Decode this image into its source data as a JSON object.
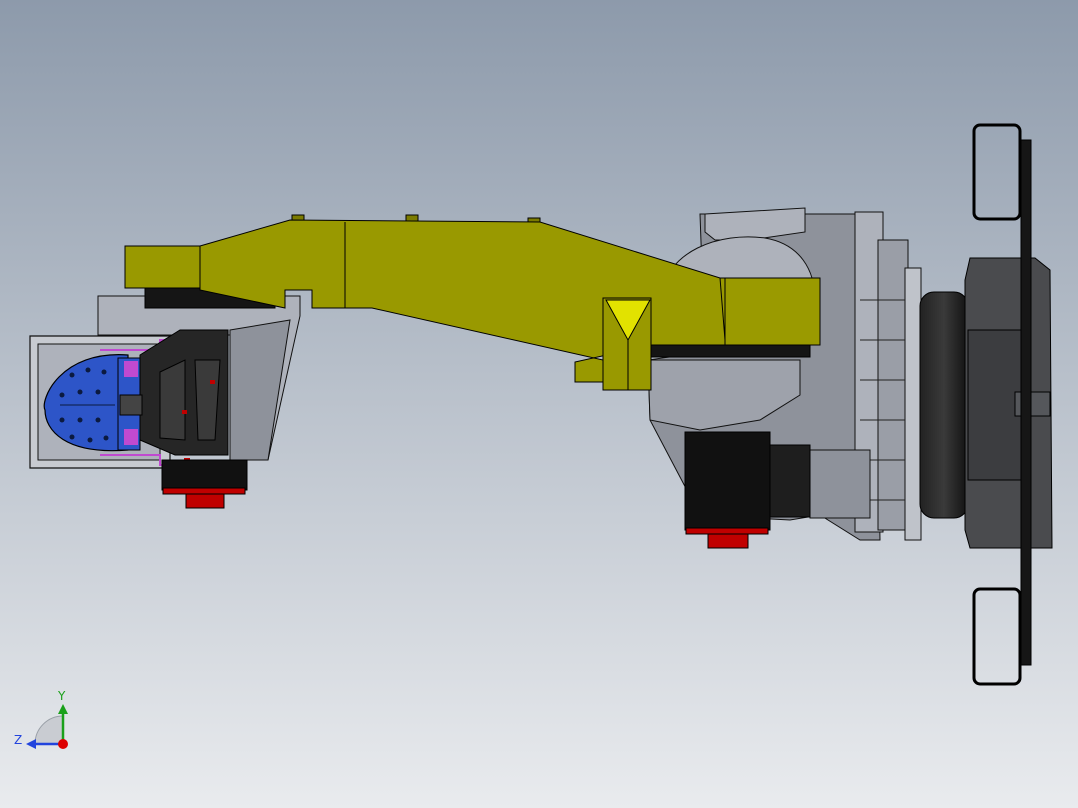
{
  "viewport": {
    "background_top": "#8d9aab",
    "background_bottom": "#e9ebee"
  },
  "model": {
    "colors": {
      "arm_yellow": "#999900",
      "arm_yellow_dark": "#7b7b00",
      "marker_yellow": "#e2e200",
      "gray_light": "#aeb2bb",
      "gray_mid": "#8e929b",
      "gray_dark": "#5e6168",
      "housing_dark": "#4a4b4e",
      "black": "#111111",
      "red": "#c00000",
      "motor_blue": "#2d55c8",
      "magenta": "#c04ad0"
    }
  },
  "triad": {
    "y_label": "Y",
    "z_label": "Z",
    "y_color": "#1aa01a",
    "z_color": "#2244dd",
    "x_color": "#dd0000"
  }
}
